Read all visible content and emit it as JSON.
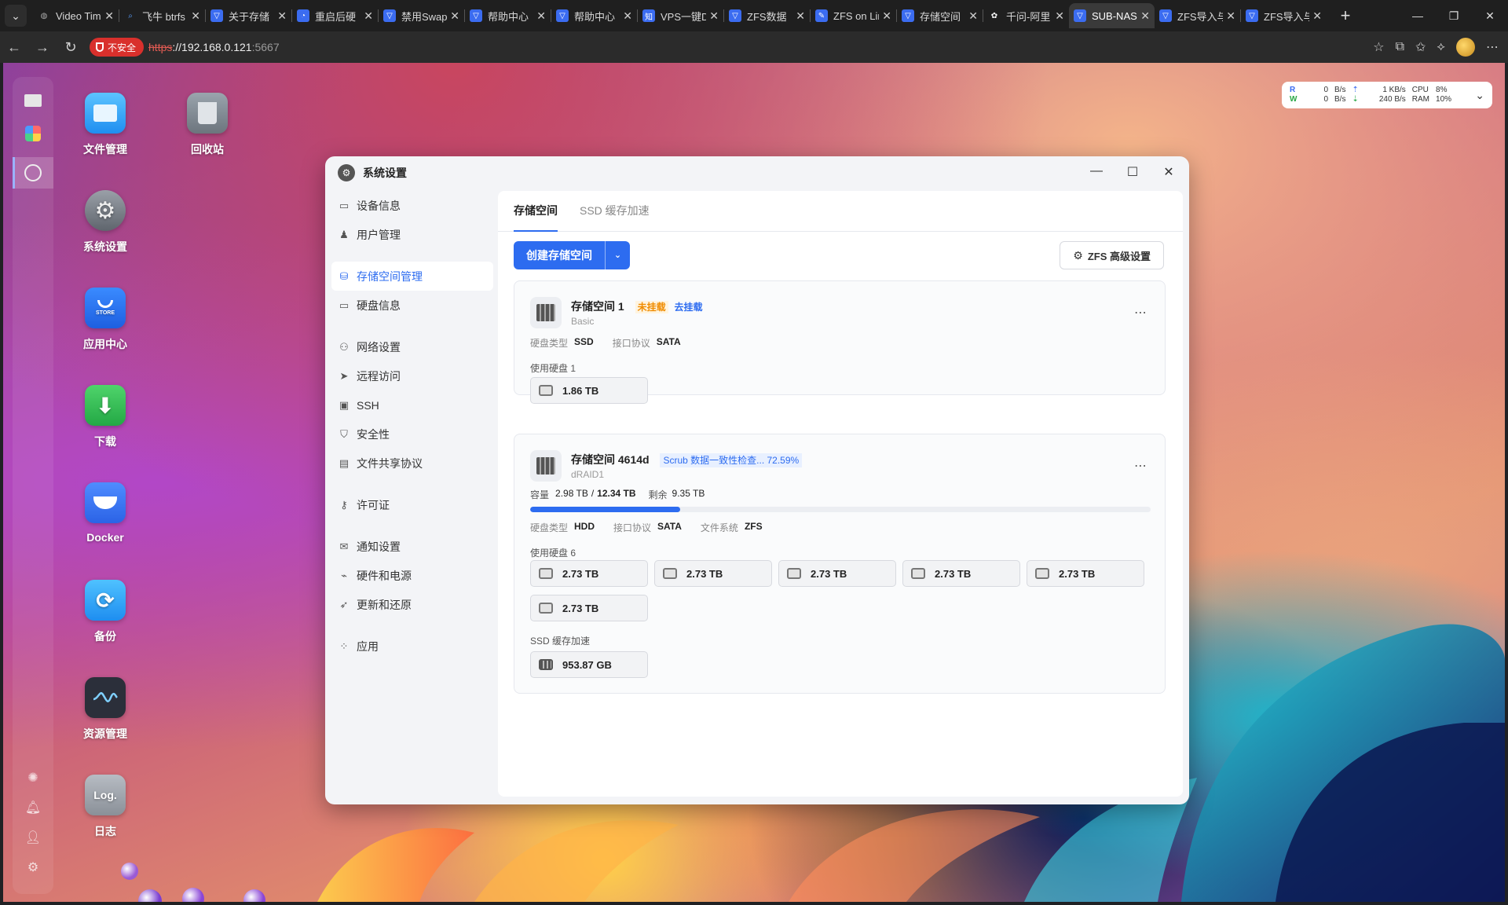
{
  "browser": {
    "tabs": [
      {
        "label": "Video Tim",
        "icon": "globe-icon",
        "active": false
      },
      {
        "label": "飞牛 btrfs",
        "icon": "search-icon",
        "active": false
      },
      {
        "label": "关于存储",
        "icon": "fn-icon",
        "active": false
      },
      {
        "label": "重启后硬",
        "icon": "chat-icon",
        "active": false
      },
      {
        "label": "禁用Swap",
        "icon": "fn-icon",
        "active": false
      },
      {
        "label": "帮助中心",
        "icon": "fn-icon",
        "active": false
      },
      {
        "label": "帮助中心",
        "icon": "fn-icon",
        "active": false
      },
      {
        "label": "VPS一键D",
        "icon": "zhihu-icon",
        "active": false
      },
      {
        "label": "ZFS数据",
        "icon": "fn-icon",
        "active": false
      },
      {
        "label": "ZFS on Lin",
        "icon": "doc-icon",
        "active": false
      },
      {
        "label": "存储空间",
        "icon": "fn-icon",
        "active": false
      },
      {
        "label": "千问-阿里",
        "icon": "qwen-icon",
        "active": false
      },
      {
        "label": "SUB-NAS",
        "icon": "fn-icon",
        "active": true
      },
      {
        "label": "ZFS导入与",
        "icon": "fn-icon",
        "active": false
      },
      {
        "label": "ZFS导入与",
        "icon": "fn-icon",
        "active": false
      }
    ],
    "address": {
      "insecure_label": "不安全",
      "scheme": "https",
      "host": "://192.168.0.121",
      "port": ":5667"
    }
  },
  "monitor": {
    "r_label": "R",
    "w_label": "W",
    "r_rate": "0",
    "w_rate": "0",
    "unit1": "B/s",
    "unit2": "B/s",
    "down_rate": "1 KB/s",
    "up_rate": "240  B/s",
    "cpu_label": "CPU",
    "ram_label": "RAM",
    "cpu": "8%",
    "ram": "10%"
  },
  "desktop_apps": [
    {
      "label": "文件管理",
      "name": "file-manager"
    },
    {
      "label": "回收站",
      "name": "recycle-bin"
    },
    {
      "label": "系统设置",
      "name": "system-settings"
    },
    {
      "label": "应用中心",
      "name": "app-center"
    },
    {
      "label": "下载",
      "name": "download"
    },
    {
      "label": "Docker",
      "name": "docker"
    },
    {
      "label": "备份",
      "name": "backup"
    },
    {
      "label": "资源管理",
      "name": "resource-monitor"
    },
    {
      "label": "日志",
      "name": "logs"
    }
  ],
  "store_text": "STORE",
  "log_text": "Log.",
  "window": {
    "title": "系统设置",
    "sidebar": [
      {
        "label": "设备信息",
        "icon": "device-icon"
      },
      {
        "label": "用户管理",
        "icon": "user-icon"
      },
      {
        "label": "存储空间管理",
        "icon": "storage-icon",
        "active": true
      },
      {
        "label": "硬盘信息",
        "icon": "disk-icon"
      },
      {
        "label": "网络设置",
        "icon": "network-icon"
      },
      {
        "label": "远程访问",
        "icon": "send-icon"
      },
      {
        "label": "SSH",
        "icon": "terminal-icon"
      },
      {
        "label": "安全性",
        "icon": "shield-icon"
      },
      {
        "label": "文件共享协议",
        "icon": "file-icon"
      },
      {
        "label": "许可证",
        "icon": "key-icon"
      },
      {
        "label": "通知设置",
        "icon": "mail-icon"
      },
      {
        "label": "硬件和电源",
        "icon": "power-icon"
      },
      {
        "label": "更新和还原",
        "icon": "rocket-icon"
      },
      {
        "label": "应用",
        "icon": "apps-icon"
      }
    ],
    "tabs": [
      "存储空间",
      "SSD 缓存加速"
    ],
    "create_button": "创建存储空间",
    "zfs_button": "ZFS 高级设置",
    "pool1": {
      "name": "存储空间 1",
      "status": "未挂载",
      "action": "去挂载",
      "type": "Basic",
      "disk_type_label": "硬盘类型",
      "disk_type": "SSD",
      "iface_label": "接口协议",
      "iface": "SATA",
      "used_disks_label": "使用硬盘 1",
      "disks": [
        "1.86 TB"
      ]
    },
    "pool2": {
      "name": "存储空间 4614d",
      "scrub": "Scrub 数据一致性检查... 72.59%",
      "type": "dRAID1",
      "capacity_label": "容量",
      "used": "2.98 TB",
      "slash": "/",
      "total": "12.34 TB",
      "free_label": "剩余",
      "free": "9.35 TB",
      "usage_fraction": 0.2415,
      "disk_type_label": "硬盘类型",
      "disk_type": "HDD",
      "iface_label": "接口协议",
      "iface": "SATA",
      "fs_label": "文件系统",
      "fs": "ZFS",
      "used_disks_label": "使用硬盘 6",
      "disks": [
        "2.73 TB",
        "2.73 TB",
        "2.73 TB",
        "2.73 TB",
        "2.73 TB",
        "2.73 TB"
      ],
      "cache_label": "SSD 缓存加速",
      "cache_disk": "953.87 GB"
    }
  }
}
